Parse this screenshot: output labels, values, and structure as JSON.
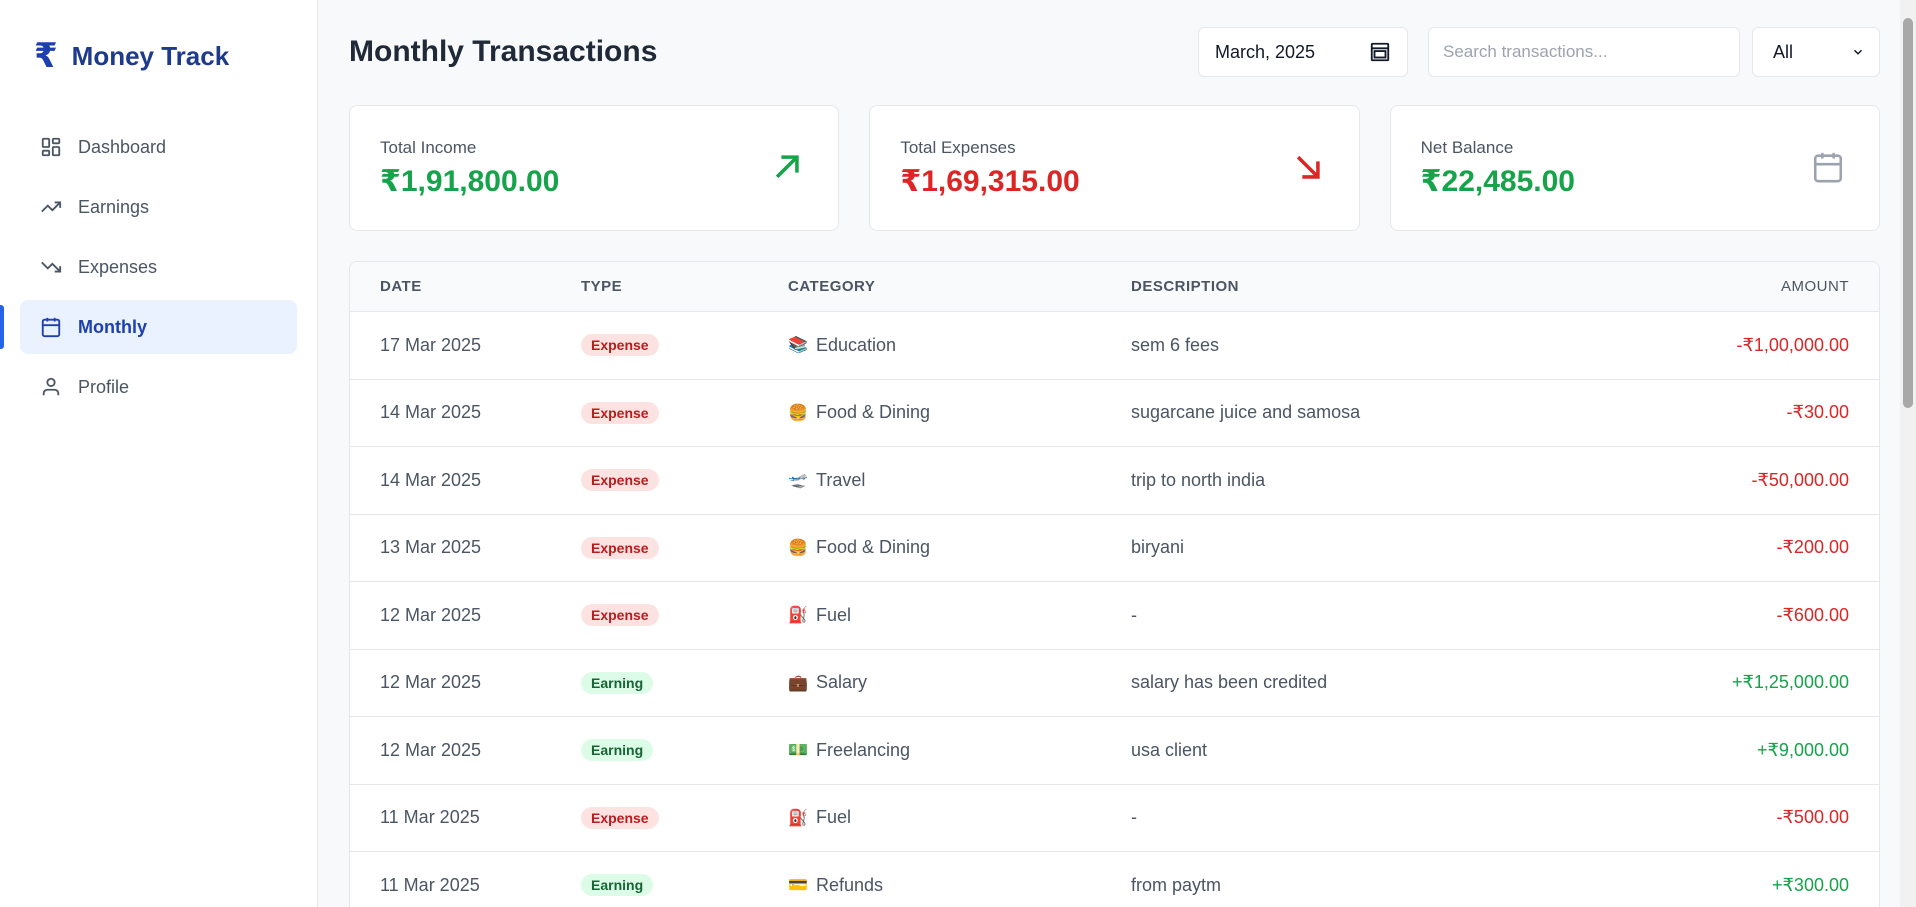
{
  "brand": {
    "name": "Money Track",
    "icon": "₹"
  },
  "sidebar": {
    "items": [
      {
        "label": "Dashboard",
        "icon": "grid-icon",
        "active": false
      },
      {
        "label": "Earnings",
        "icon": "trend-up-icon",
        "active": false
      },
      {
        "label": "Expenses",
        "icon": "trend-down-icon",
        "active": false
      },
      {
        "label": "Monthly",
        "icon": "calendar-icon",
        "active": true
      },
      {
        "label": "Profile",
        "icon": "user-icon",
        "active": false
      }
    ]
  },
  "header": {
    "title": "Monthly Transactions",
    "month": "March, 2025",
    "search_placeholder": "Search transactions...",
    "filter_value": "All"
  },
  "summary": {
    "income": {
      "label": "Total Income",
      "value": "₹1,91,800.00",
      "icon": "arrow-up-right-icon",
      "color": "#16a34a"
    },
    "expenses": {
      "label": "Total Expenses",
      "value": "₹1,69,315.00",
      "icon": "arrow-down-right-icon",
      "color": "#dc2626"
    },
    "balance": {
      "label": "Net Balance",
      "value": "₹22,485.00",
      "icon": "calendar-icon",
      "color": "#16a34a"
    }
  },
  "table": {
    "headers": {
      "date": "DATE",
      "type": "TYPE",
      "category": "CATEGORY",
      "description": "DESCRIPTION",
      "amount": "AMOUNT"
    },
    "rows": [
      {
        "date": "17 Mar 2025",
        "type": "Expense",
        "category_icon": "📚",
        "category": "Education",
        "description": "sem 6 fees",
        "amount": "-₹1,00,000.00"
      },
      {
        "date": "14 Mar 2025",
        "type": "Expense",
        "category_icon": "🍔",
        "category": "Food & Dining",
        "description": "sugarcane juice and samosa",
        "amount": "-₹30.00"
      },
      {
        "date": "14 Mar 2025",
        "type": "Expense",
        "category_icon": "🛫",
        "category": "Travel",
        "description": "trip to north india",
        "amount": "-₹50,000.00"
      },
      {
        "date": "13 Mar 2025",
        "type": "Expense",
        "category_icon": "🍔",
        "category": "Food & Dining",
        "description": "biryani",
        "amount": "-₹200.00"
      },
      {
        "date": "12 Mar 2025",
        "type": "Expense",
        "category_icon": "⛽",
        "category": "Fuel",
        "description": "-",
        "amount": "-₹600.00"
      },
      {
        "date": "12 Mar 2025",
        "type": "Earning",
        "category_icon": "💼",
        "category": "Salary",
        "description": "salary has been credited",
        "amount": "+₹1,25,000.00"
      },
      {
        "date": "12 Mar 2025",
        "type": "Earning",
        "category_icon": "💵",
        "category": "Freelancing",
        "description": "usa client",
        "amount": "+₹9,000.00"
      },
      {
        "date": "11 Mar 2025",
        "type": "Expense",
        "category_icon": "⛽",
        "category": "Fuel",
        "description": "-",
        "amount": "-₹500.00"
      },
      {
        "date": "11 Mar 2025",
        "type": "Earning",
        "category_icon": "💳",
        "category": "Refunds",
        "description": "from paytm",
        "amount": "+₹300.00"
      }
    ]
  }
}
